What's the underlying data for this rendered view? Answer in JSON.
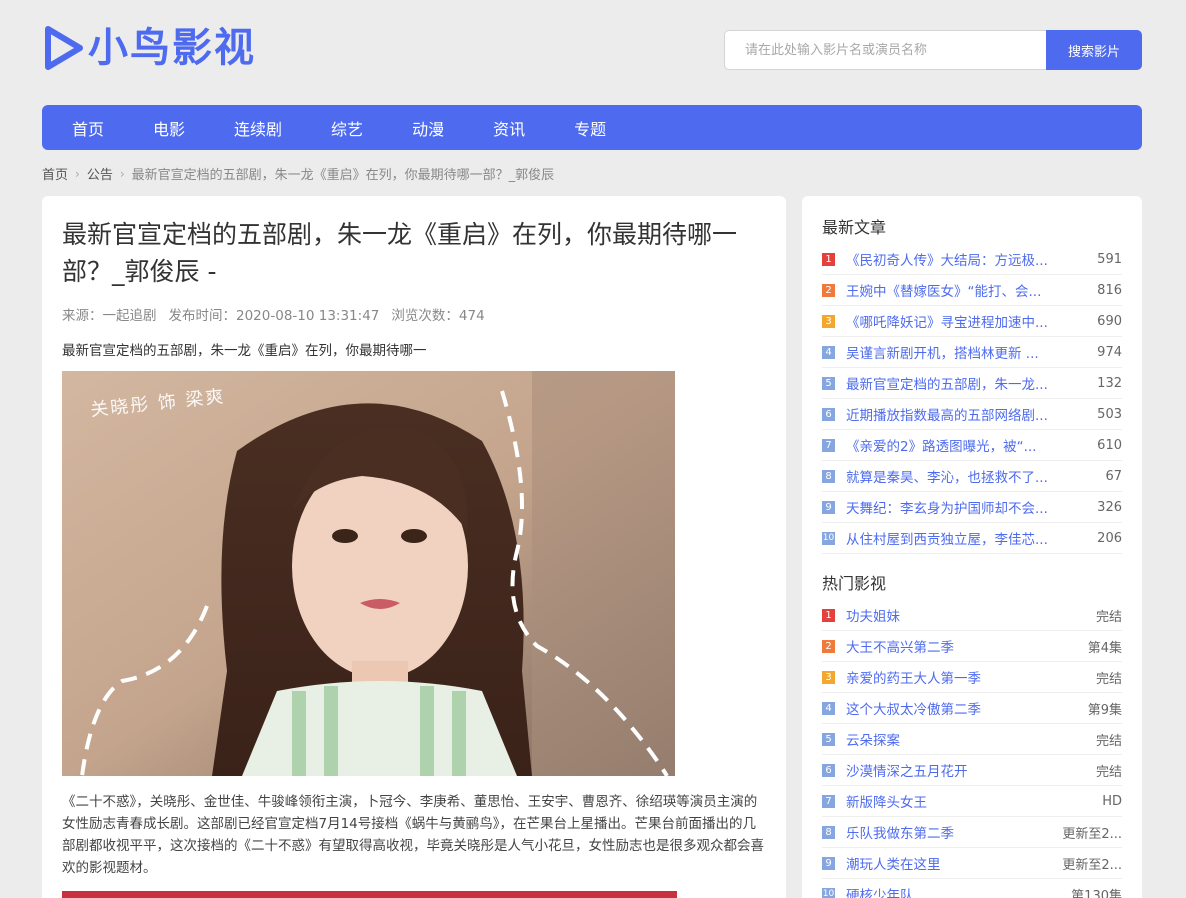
{
  "header": {
    "logo_text": "小鸟影视",
    "search_placeholder": "请在此处输入影片名或演员名称",
    "search_button": "搜索影片"
  },
  "nav": [
    "首页",
    "电影",
    "连续剧",
    "综艺",
    "动漫",
    "资讯",
    "专题"
  ],
  "breadcrumb": [
    "首页",
    "公告",
    "最新官宣定档的五部剧，朱一龙《重启》在列，你最期待哪一部？_郭俊辰"
  ],
  "article": {
    "title": "最新官宣定档的五部剧，朱一龙《重启》在列，你最期待哪一部？_郭俊辰 -",
    "source": "来源：一起追剧",
    "time": "发布时间：2020-08-10 13:31:47",
    "views": "浏览次数：474",
    "summary": "最新官宣定档的五部剧，朱一龙《重启》在列，你最期待哪一",
    "image_caption": "关晓彤 饰 梁爽",
    "body": "《二十不惑》，关晓彤、金世佳、牛骏峰领衔主演，卜冠今、李庚希、董思怡、王安宇、曹恩齐、徐绍瑛等演员主演的女性励志青春成长剧。这部剧已经官宣定档7月14号接档《蜗牛与黄鹂鸟》，在芒果台上星播出。芒果台前面播出的几部剧都收视平平，这次接档的《二十不惑》有望取得高收视，毕竟关晓彤是人气小花旦，女性励志也是很多观众都会喜欢的影视题材。"
  },
  "latest": {
    "title": "最新文章",
    "items": [
      {
        "rank": "1",
        "title": "《民初奇人传》大结局：方远极...",
        "count": "591"
      },
      {
        "rank": "2",
        "title": "王婉中《替嫁医女》“能打、会...",
        "count": "816"
      },
      {
        "rank": "3",
        "title": "《哪吒降妖记》寻宝进程加速中...",
        "count": "690"
      },
      {
        "rank": "4",
        "title": "吴谨言新剧开机，搭档林更新 ...",
        "count": "974"
      },
      {
        "rank": "5",
        "title": "最新官宣定档的五部剧，朱一龙...",
        "count": "132"
      },
      {
        "rank": "6",
        "title": "近期播放指数最高的五部网络剧...",
        "count": "503"
      },
      {
        "rank": "7",
        "title": "《亲爱的2》路透图曝光，被“...",
        "count": "610"
      },
      {
        "rank": "8",
        "title": "就算是秦昊、李沁，也拯救不了...",
        "count": "67"
      },
      {
        "rank": "9",
        "title": "天舞纪：李玄身为护国师却不会...",
        "count": "326"
      },
      {
        "rank": "10",
        "title": "从住村屋到西贡独立屋，李佳芯...",
        "count": "206"
      }
    ]
  },
  "hot": {
    "title": "热门影视",
    "items": [
      {
        "rank": "1",
        "title": "功夫姐妹",
        "status": "完结"
      },
      {
        "rank": "2",
        "title": "大王不高兴第二季",
        "status": "第4集"
      },
      {
        "rank": "3",
        "title": "亲爱的药王大人第一季",
        "status": "完结"
      },
      {
        "rank": "4",
        "title": "这个大叔太冷傲第二季",
        "status": "第9集"
      },
      {
        "rank": "5",
        "title": "云朵探案",
        "status": "完结"
      },
      {
        "rank": "6",
        "title": "沙漠情深之五月花开",
        "status": "完结"
      },
      {
        "rank": "7",
        "title": "新版降头女王",
        "status": "HD"
      },
      {
        "rank": "8",
        "title": "乐队我做东第二季",
        "status": "更新至2..."
      },
      {
        "rank": "9",
        "title": "潮玩人类在这里",
        "status": "更新至2..."
      },
      {
        "rank": "10",
        "title": "硬核少年队",
        "status": "第130集"
      }
    ]
  },
  "colors": {
    "accent": "#4e6bef",
    "rank1": "#e5413c",
    "rank2": "#ef7a3b",
    "rank3": "#f3a72f",
    "rank_other": "#86a6e0"
  }
}
